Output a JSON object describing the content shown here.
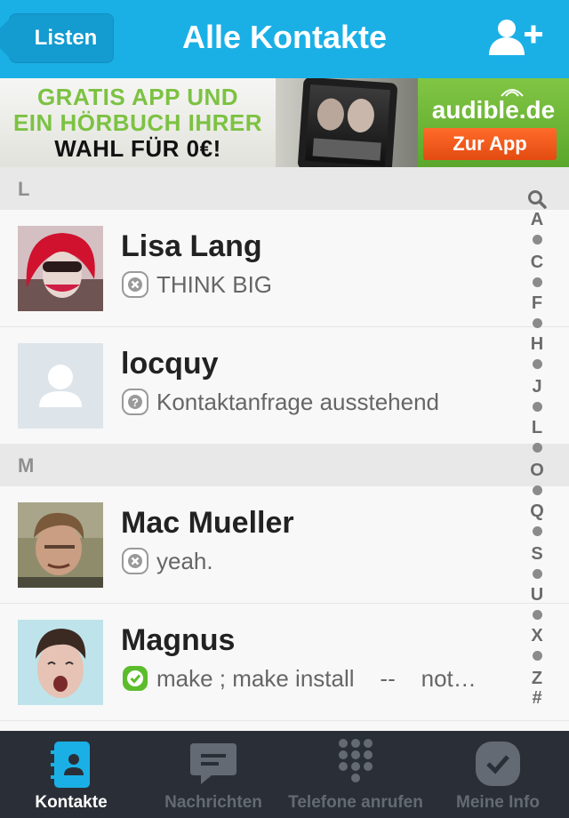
{
  "header": {
    "back_label": "Listen",
    "title": "Alle Kontakte"
  },
  "ad": {
    "line1": "GRATIS APP UND",
    "line2": "EIN HÖRBUCH IHRER",
    "line3": "WAHL FÜR 0€!",
    "brand": "audible.de",
    "cta": "Zur App"
  },
  "sections": [
    {
      "letter": "L"
    },
    {
      "letter": "M"
    }
  ],
  "contacts": [
    {
      "name": "Lisa Lang",
      "status_icon": "offline-x-icon",
      "status": "THINK BIG"
    },
    {
      "name": "locquy",
      "status_icon": "question-icon",
      "status": "Kontaktanfrage ausstehend"
    },
    {
      "name": "Mac Mueller",
      "status_icon": "offline-x-icon",
      "status": "yeah."
    },
    {
      "name": "Magnus",
      "status_icon": "online-check-icon",
      "status": "make ; make install    --    not…"
    }
  ],
  "index": [
    "A",
    "C",
    "F",
    "H",
    "J",
    "L",
    "O",
    "Q",
    "S",
    "U",
    "X",
    "Z",
    "#"
  ],
  "tabs": [
    {
      "label": "Kontakte",
      "icon": "contacts-book-icon",
      "active": true
    },
    {
      "label": "Nachrichten",
      "icon": "chat-bubble-icon",
      "active": false
    },
    {
      "label": "Telefone anrufen",
      "icon": "dialpad-icon",
      "active": false
    },
    {
      "label": "Meine Info",
      "icon": "skype-check-icon",
      "active": false
    }
  ],
  "colors": {
    "header": "#1ab0e6",
    "tabbar": "#2a2f37",
    "online": "#5bbd2b"
  }
}
